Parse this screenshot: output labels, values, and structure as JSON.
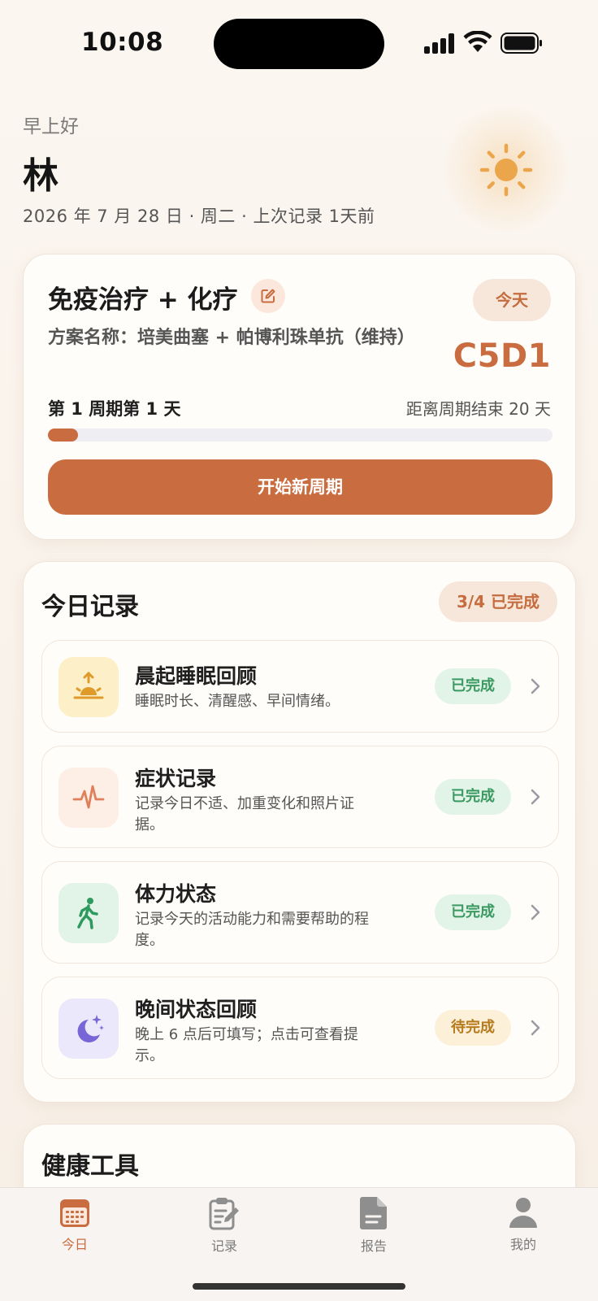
{
  "status_bar": {
    "time": "10:08"
  },
  "greeting": {
    "salutation": "早上好",
    "name": "林",
    "date_line": "2026 年 7 月 28 日 · 周二 · 上次记录 1天前"
  },
  "plan": {
    "title": "免疫治疗 + 化疗",
    "today_badge": "今天",
    "plan_name": "方案名称：培美曲塞 + 帕博利珠单抗（维持）",
    "cycle_code": "C5D1",
    "cycle_day_label": "第 1 周期第 1 天",
    "days_left_label": "距离周期结束 20 天",
    "progress_fraction": 0.06,
    "new_cycle_button": "开始新周期"
  },
  "today_records": {
    "title": "今日记录",
    "count_badge": "3/4 已完成",
    "items": [
      {
        "title": "晨起睡眠回顾",
        "desc": "睡眠时长、清醒感、早间情绪。",
        "status": "已完成",
        "icon": "sunrise-icon",
        "icon_bg": "#fdf0c8",
        "icon_color": "#e09a2a"
      },
      {
        "title": "症状记录",
        "desc": "记录今日不适、加重变化和照片证据。",
        "status": "已完成",
        "icon": "pulse-icon",
        "icon_bg": "#fdeee6",
        "icon_color": "#e0805a"
      },
      {
        "title": "体力状态",
        "desc": "记录今天的活动能力和需要帮助的程度。",
        "status": "已完成",
        "icon": "walking-icon",
        "icon_bg": "#e2f3e8",
        "icon_color": "#2f9a5e"
      },
      {
        "title": "晚间状态回顾",
        "desc": "晚上 6 点后可填写；点击可查看提示。",
        "status": "待完成",
        "icon": "moon-stars-icon",
        "icon_bg": "#ece8fb",
        "icon_color": "#7866d6"
      }
    ]
  },
  "tools": {
    "title": "健康工具"
  },
  "tab_bar": {
    "tabs": [
      {
        "label": "今日",
        "icon": "calendar-icon",
        "active": true
      },
      {
        "label": "记录",
        "icon": "clipboard-edit-icon",
        "active": false
      },
      {
        "label": "报告",
        "icon": "document-icon",
        "active": false
      },
      {
        "label": "我的",
        "icon": "person-icon",
        "active": false
      }
    ]
  },
  "colors": {
    "accent": "#c96d40",
    "done_bg": "#e2f3e8",
    "done_text": "#3b9a62",
    "todo_bg": "#fcf0d9",
    "todo_text": "#b77b1e"
  }
}
